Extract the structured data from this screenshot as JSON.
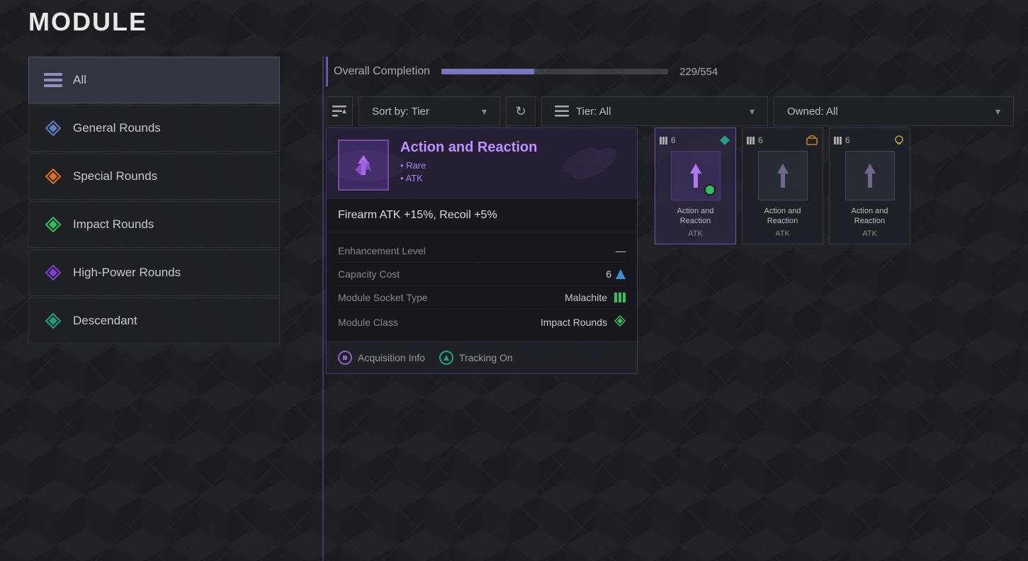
{
  "page": {
    "title": "Module"
  },
  "sidebar": {
    "items": [
      {
        "id": "all",
        "label": "All",
        "icon": "layers",
        "active": true
      },
      {
        "id": "general-rounds",
        "label": "General Rounds",
        "icon": "diamond-blue"
      },
      {
        "id": "special-rounds",
        "label": "Special Rounds",
        "icon": "diamond-orange"
      },
      {
        "id": "impact-rounds",
        "label": "Impact Rounds",
        "icon": "diamond-green"
      },
      {
        "id": "high-power-rounds",
        "label": "High-Power Rounds",
        "icon": "diamond-purple"
      },
      {
        "id": "descendant",
        "label": "Descendant",
        "icon": "diamond-teal"
      }
    ]
  },
  "completion": {
    "label": "Overall Completion",
    "current": 229,
    "total": 554,
    "display": "229/554",
    "percent": 41
  },
  "filters": {
    "sort_icon_label": "≡↑",
    "sort_label": "Sort by: Tier",
    "refresh_icon": "↻",
    "tier_icon": "≡",
    "tier_label": "Tier: All",
    "owned_label": "Owned: All",
    "chevron": "▾"
  },
  "selected_module": {
    "name": "Action and Reaction",
    "rarity": "• Rare",
    "class": "• ATK",
    "effect": "Firearm ATK +15%, Recoil +5%",
    "stats": [
      {
        "label": "Enhancement Level",
        "value": "—"
      },
      {
        "label": "Capacity Cost",
        "value": "6",
        "icon": "capacity"
      },
      {
        "label": "Module Socket Type",
        "value": "Malachite",
        "icon": "malachite"
      },
      {
        "label": "Module Class",
        "value": "Impact Rounds",
        "icon": "impact"
      }
    ],
    "actions": [
      {
        "label": "Acquisition Info",
        "icon": "circle-square",
        "color": "purple"
      },
      {
        "label": "Tracking On",
        "icon": "circle-triangle",
        "color": "teal"
      }
    ]
  },
  "module_cards": [
    {
      "name": "Action and\nReaction",
      "tag": "ATK",
      "tier": "6",
      "top_icon": "teal-diamond",
      "selected": true,
      "equipped": true
    },
    {
      "name": "Action and\nReaction",
      "tag": "ATK",
      "tier": "6",
      "top_icon": "orange-tag",
      "selected": false,
      "equipped": false
    },
    {
      "name": "Action and\nReaction",
      "tag": "ATK",
      "tier": "6",
      "top_icon": "yellow-skull",
      "selected": false,
      "equipped": false
    }
  ],
  "icons": {
    "layers": "≡",
    "sort": "⇅",
    "refresh": "↻",
    "tier": "≡",
    "chevron_down": "▾"
  }
}
